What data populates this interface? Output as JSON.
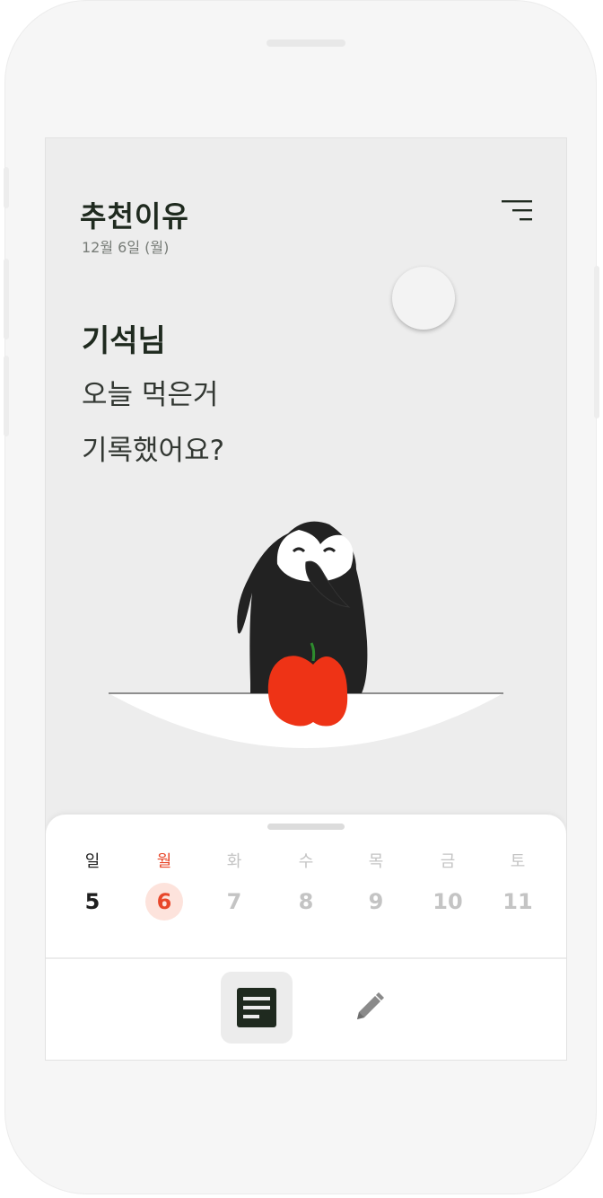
{
  "header": {
    "title": "추천이유",
    "date": "12월 6일 (월)"
  },
  "greeting": {
    "name": "기석님",
    "line1": "오늘 먹은거",
    "line2": "기록했어요?"
  },
  "calendar": {
    "selected_index": 1,
    "days": [
      {
        "dow": "일",
        "num": "5",
        "state": "normal"
      },
      {
        "dow": "월",
        "num": "6",
        "state": "selected"
      },
      {
        "dow": "화",
        "num": "7",
        "state": "disabled"
      },
      {
        "dow": "수",
        "num": "8",
        "state": "disabled"
      },
      {
        "dow": "목",
        "num": "9",
        "state": "disabled"
      },
      {
        "dow": "금",
        "num": "10",
        "state": "disabled"
      },
      {
        "dow": "토",
        "num": "11",
        "state": "disabled"
      }
    ]
  },
  "tabs": {
    "active": "list",
    "items": [
      "list",
      "edit"
    ]
  },
  "colors": {
    "accent": "#e8472a",
    "dark": "#1f2a1f",
    "disabled": "#c4c4c4",
    "background": "#ededed"
  },
  "icons": {
    "menu": "menu-lines-icon",
    "list": "document-list-icon",
    "edit": "pencil-icon"
  }
}
